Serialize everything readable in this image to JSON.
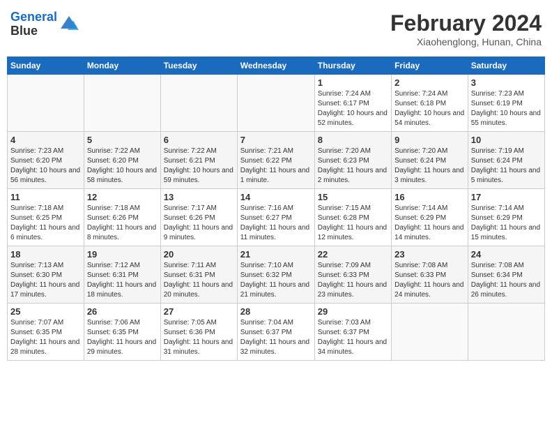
{
  "header": {
    "logo_line1": "General",
    "logo_line2": "Blue",
    "month_title": "February 2024",
    "location": "Xiaohenglong, Hunan, China"
  },
  "weekdays": [
    "Sunday",
    "Monday",
    "Tuesday",
    "Wednesday",
    "Thursday",
    "Friday",
    "Saturday"
  ],
  "weeks": [
    [
      {
        "day": "",
        "info": ""
      },
      {
        "day": "",
        "info": ""
      },
      {
        "day": "",
        "info": ""
      },
      {
        "day": "",
        "info": ""
      },
      {
        "day": "1",
        "info": "Sunrise: 7:24 AM\nSunset: 6:17 PM\nDaylight: 10 hours\nand 52 minutes."
      },
      {
        "day": "2",
        "info": "Sunrise: 7:24 AM\nSunset: 6:18 PM\nDaylight: 10 hours\nand 54 minutes."
      },
      {
        "day": "3",
        "info": "Sunrise: 7:23 AM\nSunset: 6:19 PM\nDaylight: 10 hours\nand 55 minutes."
      }
    ],
    [
      {
        "day": "4",
        "info": "Sunrise: 7:23 AM\nSunset: 6:20 PM\nDaylight: 10 hours\nand 56 minutes."
      },
      {
        "day": "5",
        "info": "Sunrise: 7:22 AM\nSunset: 6:20 PM\nDaylight: 10 hours\nand 58 minutes."
      },
      {
        "day": "6",
        "info": "Sunrise: 7:22 AM\nSunset: 6:21 PM\nDaylight: 10 hours\nand 59 minutes."
      },
      {
        "day": "7",
        "info": "Sunrise: 7:21 AM\nSunset: 6:22 PM\nDaylight: 11 hours\nand 1 minute."
      },
      {
        "day": "8",
        "info": "Sunrise: 7:20 AM\nSunset: 6:23 PM\nDaylight: 11 hours\nand 2 minutes."
      },
      {
        "day": "9",
        "info": "Sunrise: 7:20 AM\nSunset: 6:24 PM\nDaylight: 11 hours\nand 3 minutes."
      },
      {
        "day": "10",
        "info": "Sunrise: 7:19 AM\nSunset: 6:24 PM\nDaylight: 11 hours\nand 5 minutes."
      }
    ],
    [
      {
        "day": "11",
        "info": "Sunrise: 7:18 AM\nSunset: 6:25 PM\nDaylight: 11 hours\nand 6 minutes."
      },
      {
        "day": "12",
        "info": "Sunrise: 7:18 AM\nSunset: 6:26 PM\nDaylight: 11 hours\nand 8 minutes."
      },
      {
        "day": "13",
        "info": "Sunrise: 7:17 AM\nSunset: 6:26 PM\nDaylight: 11 hours\nand 9 minutes."
      },
      {
        "day": "14",
        "info": "Sunrise: 7:16 AM\nSunset: 6:27 PM\nDaylight: 11 hours\nand 11 minutes."
      },
      {
        "day": "15",
        "info": "Sunrise: 7:15 AM\nSunset: 6:28 PM\nDaylight: 11 hours\nand 12 minutes."
      },
      {
        "day": "16",
        "info": "Sunrise: 7:14 AM\nSunset: 6:29 PM\nDaylight: 11 hours\nand 14 minutes."
      },
      {
        "day": "17",
        "info": "Sunrise: 7:14 AM\nSunset: 6:29 PM\nDaylight: 11 hours\nand 15 minutes."
      }
    ],
    [
      {
        "day": "18",
        "info": "Sunrise: 7:13 AM\nSunset: 6:30 PM\nDaylight: 11 hours\nand 17 minutes."
      },
      {
        "day": "19",
        "info": "Sunrise: 7:12 AM\nSunset: 6:31 PM\nDaylight: 11 hours\nand 18 minutes."
      },
      {
        "day": "20",
        "info": "Sunrise: 7:11 AM\nSunset: 6:31 PM\nDaylight: 11 hours\nand 20 minutes."
      },
      {
        "day": "21",
        "info": "Sunrise: 7:10 AM\nSunset: 6:32 PM\nDaylight: 11 hours\nand 21 minutes."
      },
      {
        "day": "22",
        "info": "Sunrise: 7:09 AM\nSunset: 6:33 PM\nDaylight: 11 hours\nand 23 minutes."
      },
      {
        "day": "23",
        "info": "Sunrise: 7:08 AM\nSunset: 6:33 PM\nDaylight: 11 hours\nand 24 minutes."
      },
      {
        "day": "24",
        "info": "Sunrise: 7:08 AM\nSunset: 6:34 PM\nDaylight: 11 hours\nand 26 minutes."
      }
    ],
    [
      {
        "day": "25",
        "info": "Sunrise: 7:07 AM\nSunset: 6:35 PM\nDaylight: 11 hours\nand 28 minutes."
      },
      {
        "day": "26",
        "info": "Sunrise: 7:06 AM\nSunset: 6:35 PM\nDaylight: 11 hours\nand 29 minutes."
      },
      {
        "day": "27",
        "info": "Sunrise: 7:05 AM\nSunset: 6:36 PM\nDaylight: 11 hours\nand 31 minutes."
      },
      {
        "day": "28",
        "info": "Sunrise: 7:04 AM\nSunset: 6:37 PM\nDaylight: 11 hours\nand 32 minutes."
      },
      {
        "day": "29",
        "info": "Sunrise: 7:03 AM\nSunset: 6:37 PM\nDaylight: 11 hours\nand 34 minutes."
      },
      {
        "day": "",
        "info": ""
      },
      {
        "day": "",
        "info": ""
      }
    ]
  ]
}
